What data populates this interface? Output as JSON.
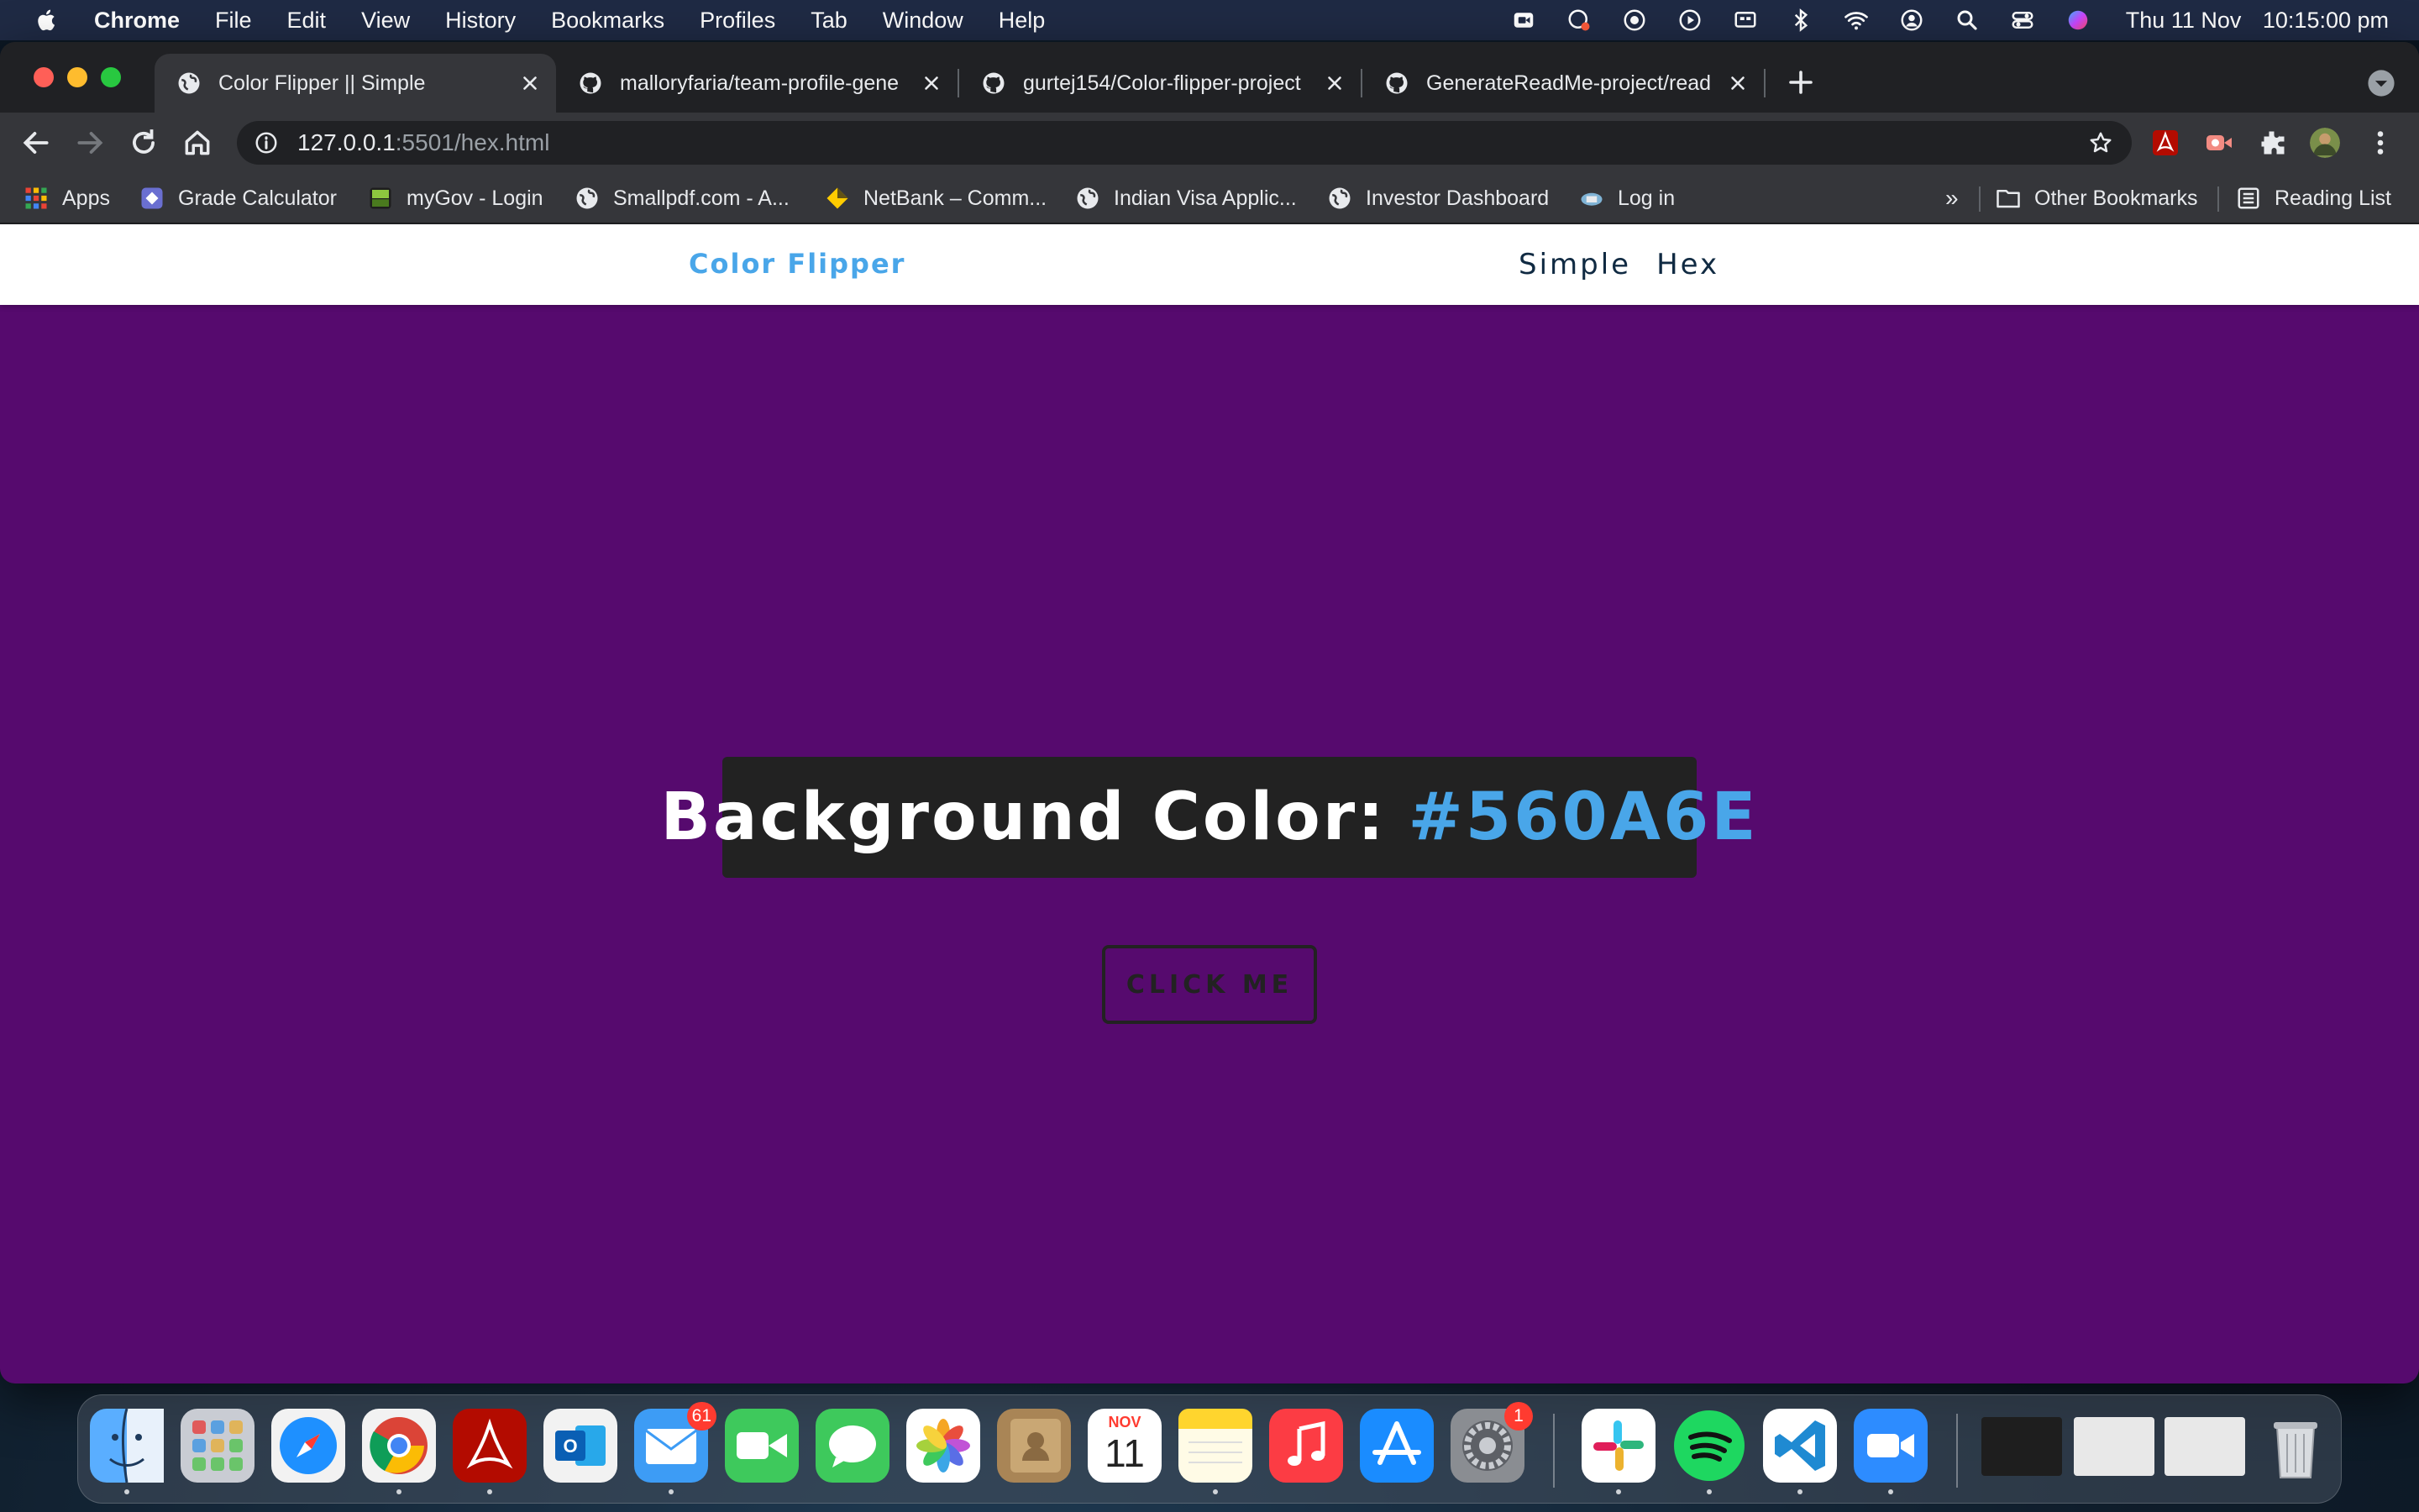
{
  "menubar": {
    "app_name": "Chrome",
    "menus": [
      "File",
      "Edit",
      "View",
      "History",
      "Bookmarks",
      "Profiles",
      "Tab",
      "Window",
      "Help"
    ],
    "date": "Thu 11 Nov",
    "time": "10:15:00 pm"
  },
  "browser": {
    "tabs": [
      {
        "title": "Color Flipper || Simple",
        "active": true
      },
      {
        "title": "malloryfaria/team-profile-gene",
        "active": false
      },
      {
        "title": "gurtej154/Color-flipper-project",
        "active": false
      },
      {
        "title": "GenerateReadMe-project/read",
        "active": false
      }
    ],
    "url_host": "127.0.0.1",
    "url_path": ":5501/hex.html",
    "bookmarks": [
      "Apps",
      "Grade Calculator",
      "myGov - Login",
      "Smallpdf.com - A...",
      "NetBank – Comm...",
      "Indian Visa Applic...",
      "Investor Dashboard",
      "Log in"
    ],
    "overflow_label": "»",
    "other_bookmarks": "Other Bookmarks",
    "reading_list": "Reading List"
  },
  "page": {
    "brand": "Color Flipper",
    "nav_links": [
      "Simple",
      "Hex"
    ],
    "color_label": "Background Color:",
    "color_value": "#560A6E",
    "button_label": "click me",
    "background_color": "#560a6e",
    "accent_color": "#49a6e9"
  },
  "dock": {
    "apps": [
      "Finder",
      "Launchpad",
      "Safari",
      "Chrome",
      "Acrobat",
      "Outlook",
      "Mail",
      "FaceTime",
      "Messages",
      "Photos",
      "Contacts",
      "Calendar",
      "Notes",
      "Music",
      "App Store",
      "System Preferences",
      "Slack",
      "Spotify",
      "VS Code",
      "Zoom"
    ],
    "mail_badge": "61",
    "settings_badge": "1",
    "calendar_month": "NOV",
    "calendar_day": "11"
  }
}
